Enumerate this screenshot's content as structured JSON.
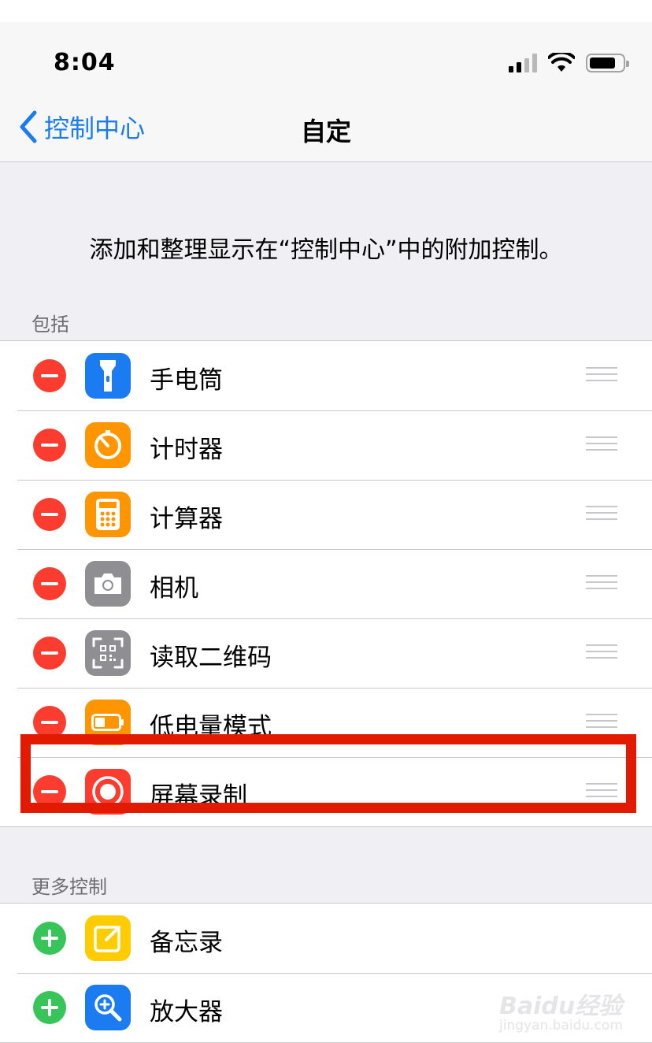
{
  "status": {
    "time": "8:04"
  },
  "nav": {
    "back_label": "控制中心",
    "title": "自定"
  },
  "description": "添加和整理显示在“控制中心”中的附加控制。",
  "included": {
    "header": "包括",
    "items": [
      {
        "label": "手电筒",
        "icon": "flashlight-icon",
        "color": "#1a7cf0"
      },
      {
        "label": "计时器",
        "icon": "timer-icon",
        "color": "#ff9500"
      },
      {
        "label": "计算器",
        "icon": "calculator-icon",
        "color": "#ff9500"
      },
      {
        "label": "相机",
        "icon": "camera-icon",
        "color": "#8e8e93"
      },
      {
        "label": "读取二维码",
        "icon": "qr-code-icon",
        "color": "#8e8e93"
      },
      {
        "label": "低电量模式",
        "icon": "low-power-battery-icon",
        "color": "#ff9500"
      },
      {
        "label": "屏幕录制",
        "icon": "screen-record-icon",
        "color": "#fb3c2f"
      }
    ]
  },
  "more": {
    "header": "更多控制",
    "items": [
      {
        "label": "备忘录",
        "icon": "notes-icon",
        "color": "#ffcc00"
      },
      {
        "label": "放大器",
        "icon": "magnifier-icon",
        "color": "#1a7cf0"
      }
    ]
  },
  "watermark": {
    "text": "Baidu经验",
    "sub": "jingyan.baidu.com"
  },
  "colors": {
    "accent": "#1a7cf0",
    "remove": "#fb3c2f",
    "add": "#37c559",
    "highlight": "#e21a00"
  }
}
